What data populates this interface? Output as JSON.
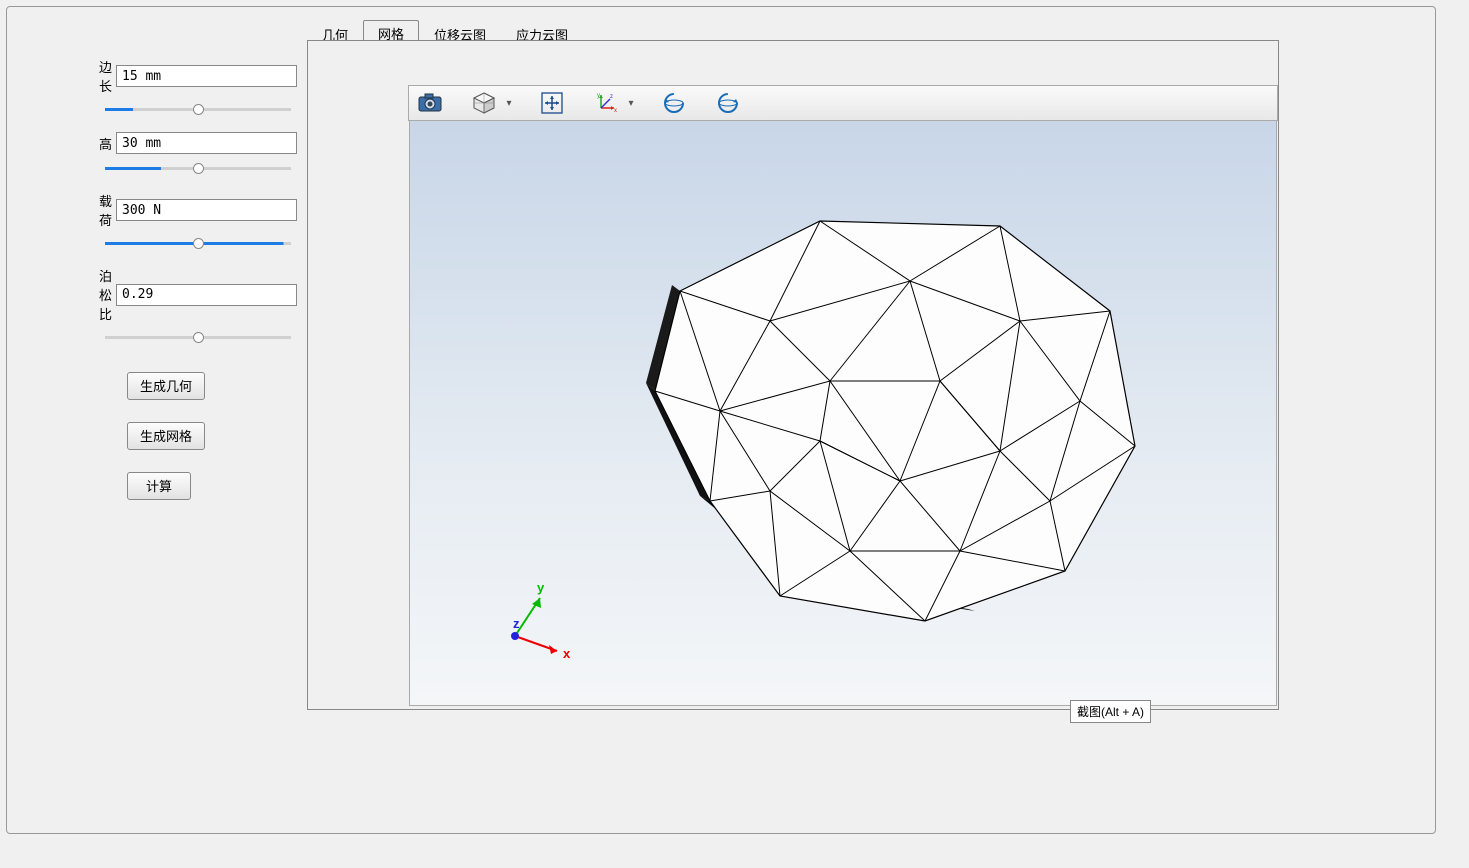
{
  "sidebar": {
    "params": [
      {
        "label": "边长",
        "value": "15 mm",
        "slider_fill": 15
      },
      {
        "label": "高",
        "value": "30 mm",
        "slider_fill": 30
      },
      {
        "label": "载荷",
        "value": "300 N",
        "slider_fill": 96
      },
      {
        "label": "泊松比",
        "value": "0.29",
        "slider_fill": 0
      }
    ],
    "buttons": {
      "generate_geometry": "生成几何",
      "generate_mesh": "生成网格",
      "compute": "计算"
    }
  },
  "tabs": [
    {
      "label": "几何",
      "active": false
    },
    {
      "label": "网格",
      "active": true
    },
    {
      "label": "位移云图",
      "active": false
    },
    {
      "label": "应力云图",
      "active": false
    }
  ],
  "viewer_toolbar": {
    "icons": [
      "camera",
      "grid-cube",
      "move-axes",
      "coord-axes",
      "rotate-left",
      "rotate-right"
    ]
  },
  "axis_labels": {
    "x": "x",
    "y": "y",
    "z": "z"
  },
  "tooltip": "截图(Alt + A)"
}
